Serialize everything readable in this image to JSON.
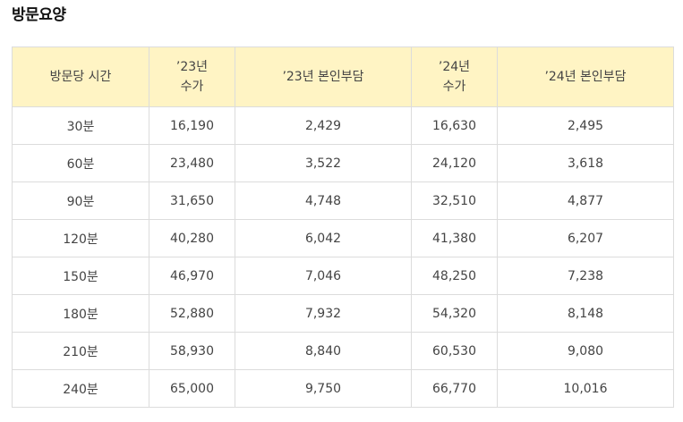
{
  "title": "방문요양",
  "table": {
    "headers": [
      {
        "lines": [
          "방문당 시간"
        ]
      },
      {
        "lines": [
          "’23년",
          "수가"
        ]
      },
      {
        "lines": [
          "’23년 본인부담"
        ]
      },
      {
        "lines": [
          "’24년",
          "수가"
        ]
      },
      {
        "lines": [
          "’24년 본인부담"
        ]
      }
    ],
    "rows": [
      [
        "30분",
        "16,190",
        "2,429",
        "16,630",
        "2,495"
      ],
      [
        "60분",
        "23,480",
        "3,522",
        "24,120",
        "3,618"
      ],
      [
        "90분",
        "31,650",
        "4,748",
        "32,510",
        "4,877"
      ],
      [
        "120분",
        "40,280",
        "6,042",
        "41,380",
        "6,207"
      ],
      [
        "150분",
        "46,970",
        "7,046",
        "48,250",
        "7,238"
      ],
      [
        "180분",
        "52,880",
        "7,932",
        "54,320",
        "8,148"
      ],
      [
        "210분",
        "58,930",
        "8,840",
        "60,530",
        "9,080"
      ],
      [
        "240분",
        "65,000",
        "9,750",
        "66,770",
        "10,016"
      ]
    ]
  },
  "colors": {
    "header_background": "#fff4c4",
    "border": "#dcdcdc"
  }
}
